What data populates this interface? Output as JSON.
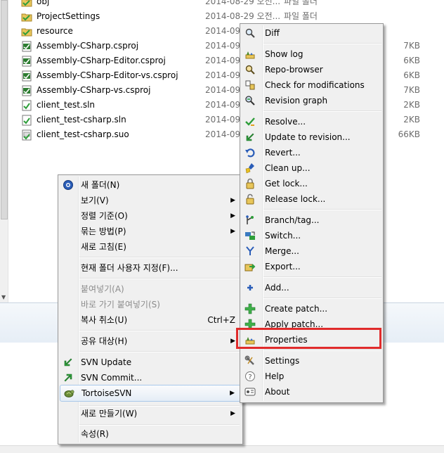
{
  "files": [
    {
      "name": "obj",
      "date": "2014-08-29 오전...",
      "type": "파일 폴더",
      "size": "",
      "icon": "folder-icon"
    },
    {
      "name": "ProjectSettings",
      "date": "2014-08-29 오전...",
      "type": "파일 폴더",
      "size": "",
      "icon": "folder-icon"
    },
    {
      "name": "resource",
      "date": "2014-09",
      "type": "",
      "size": "",
      "icon": "folder-icon"
    },
    {
      "name": "Assembly-CSharp.csproj",
      "date": "2014-09",
      "type": "",
      "size": "7KB",
      "icon": "csproj-file-icon"
    },
    {
      "name": "Assembly-CSharp-Editor.csproj",
      "date": "2014-09",
      "type": "",
      "size": "6KB",
      "icon": "csproj-file-icon"
    },
    {
      "name": "Assembly-CSharp-Editor-vs.csproj",
      "date": "2014-09",
      "type": "",
      "size": "6KB",
      "icon": "csproj-file-icon"
    },
    {
      "name": "Assembly-CSharp-vs.csproj",
      "date": "2014-09",
      "type": "",
      "size": "7KB",
      "icon": "csproj-file-icon"
    },
    {
      "name": "client_test.sln",
      "date": "2014-09",
      "type": "",
      "size": "2KB",
      "icon": "sln-file-icon"
    },
    {
      "name": "client_test-csharp.sln",
      "date": "2014-09",
      "type": "",
      "size": "2KB",
      "icon": "sln-file-icon"
    },
    {
      "name": "client_test-csharp.suo",
      "date": "2014-09",
      "type": "",
      "size": "66KB",
      "icon": "suo-file-icon"
    }
  ],
  "main_menu": {
    "new_folder": "새 폴더(N)",
    "view": "보기(V)",
    "sort_by": "정렬 기준(O)",
    "group_by": "묶는 방법(P)",
    "refresh": "새로 고침(E)",
    "customize_folder": "현재 폴더 사용자 지정(F)...",
    "paste": "붙여넣기(A)",
    "paste_shortcut": "바로 가기 붙여넣기(S)",
    "undo_copy": "복사 취소(U)",
    "undo_copy_shortcut": "Ctrl+Z",
    "share_with": "공유 대상(H)",
    "svn_update": "SVN Update",
    "svn_commit": "SVN Commit...",
    "tortoisesvn": "TortoiseSVN",
    "new": "새로 만들기(W)",
    "properties": "속성(R)"
  },
  "svn_menu": {
    "diff": "Diff",
    "show_log": "Show log",
    "repo_browser": "Repo-browser",
    "check_modifications": "Check for modifications",
    "revision_graph": "Revision graph",
    "resolve": "Resolve...",
    "update_to_revision": "Update to revision...",
    "revert": "Revert...",
    "clean_up": "Clean up...",
    "get_lock": "Get lock...",
    "release_lock": "Release lock...",
    "branch_tag": "Branch/tag...",
    "switch": "Switch...",
    "merge": "Merge...",
    "export": "Export...",
    "add": "Add...",
    "create_patch": "Create patch...",
    "apply_patch": "Apply patch...",
    "properties": "Properties",
    "settings": "Settings",
    "help": "Help",
    "about": "About"
  },
  "colors": {
    "highlight_box": "#e02b2b",
    "menu_bg": "#f0f0f0",
    "svn_green": "#2e9e3a",
    "folder_yellow": "#e8c65a"
  }
}
